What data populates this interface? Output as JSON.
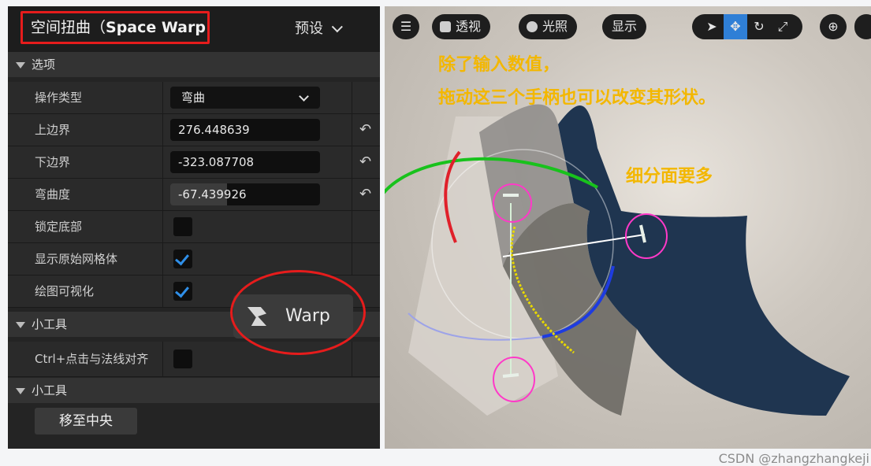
{
  "panel": {
    "title_cn": "空间扭曲（",
    "title_en": "Space Warp",
    "presets_label": "预设",
    "options_section": "选项",
    "rows": [
      {
        "label": "操作类型",
        "value": "弯曲"
      },
      {
        "label": "上边界",
        "value": "276.448639"
      },
      {
        "label": "下边界",
        "value": "-323.087708"
      },
      {
        "label": "弯曲度",
        "value": "-67.439926"
      },
      {
        "label": "锁定底部",
        "checked": false
      },
      {
        "label": "显示原始网格体",
        "checked": true
      },
      {
        "label": "绘图可视化",
        "checked": true
      }
    ],
    "gizmo_section": "小工具",
    "align_row_label": "Ctrl+点击与法线对齐",
    "gizmo_section2": "小工具",
    "center_button": "移至中央",
    "warp_tool": "Warp"
  },
  "viewport": {
    "perspective_label": "透视",
    "lighting_label": "光照",
    "show_label": "显示",
    "annotation_line1": "除了输入数值，",
    "annotation_line2": "拖动这三个手柄也可以改变其形状。",
    "annotation_subdiv": "细分面要多"
  },
  "watermark": "CSDN @zhangzhangkeji",
  "colors": {
    "annotation": "#f3b700",
    "highlight": "#e61c1c",
    "checkbox": "#2f8fe8",
    "selected_tool": "#2f7fd6"
  }
}
